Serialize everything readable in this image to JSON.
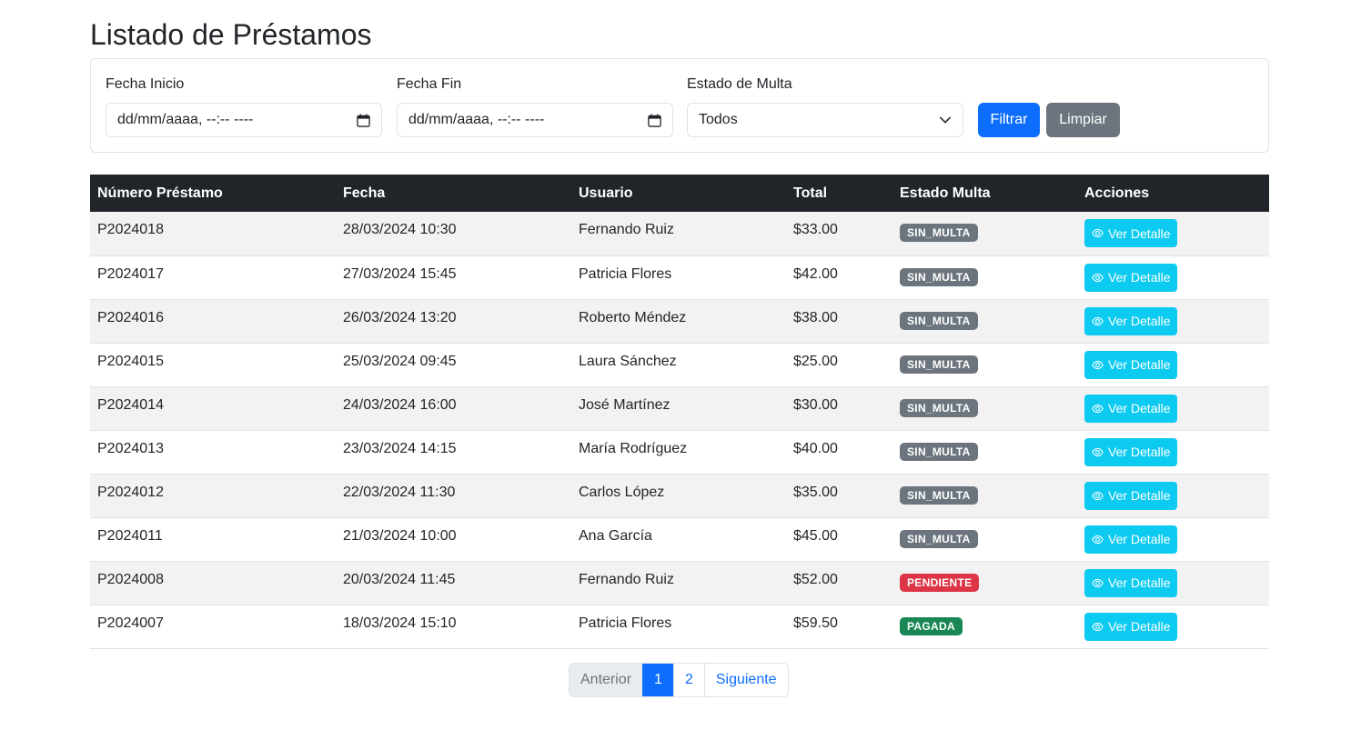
{
  "page_title": "Listado de Préstamos",
  "filters": {
    "fecha_inicio": {
      "label": "Fecha Inicio",
      "value": "dd/mm/aaaa, --:-- ----"
    },
    "fecha_fin": {
      "label": "Fecha Fin",
      "value": "dd/mm/aaaa, --:-- ----"
    },
    "estado_multa": {
      "label": "Estado de Multa",
      "value": "Todos"
    },
    "filter_button": "Filtrar",
    "clear_button": "Limpiar"
  },
  "table": {
    "headers": [
      "Número Préstamo",
      "Fecha",
      "Usuario",
      "Total",
      "Estado Multa",
      "Acciones"
    ],
    "action_label": "Ver Detalle",
    "rows": [
      {
        "numero": "P2024018",
        "fecha": "28/03/2024 10:30",
        "usuario": "Fernando Ruiz",
        "total": "$33.00",
        "estado": "SIN_MULTA"
      },
      {
        "numero": "P2024017",
        "fecha": "27/03/2024 15:45",
        "usuario": "Patricia Flores",
        "total": "$42.00",
        "estado": "SIN_MULTA"
      },
      {
        "numero": "P2024016",
        "fecha": "26/03/2024 13:20",
        "usuario": "Roberto Méndez",
        "total": "$38.00",
        "estado": "SIN_MULTA"
      },
      {
        "numero": "P2024015",
        "fecha": "25/03/2024 09:45",
        "usuario": "Laura Sánchez",
        "total": "$25.00",
        "estado": "SIN_MULTA"
      },
      {
        "numero": "P2024014",
        "fecha": "24/03/2024 16:00",
        "usuario": "José Martínez",
        "total": "$30.00",
        "estado": "SIN_MULTA"
      },
      {
        "numero": "P2024013",
        "fecha": "23/03/2024 14:15",
        "usuario": "María Rodríguez",
        "total": "$40.00",
        "estado": "SIN_MULTA"
      },
      {
        "numero": "P2024012",
        "fecha": "22/03/2024 11:30",
        "usuario": "Carlos López",
        "total": "$35.00",
        "estado": "SIN_MULTA"
      },
      {
        "numero": "P2024011",
        "fecha": "21/03/2024 10:00",
        "usuario": "Ana García",
        "total": "$45.00",
        "estado": "SIN_MULTA"
      },
      {
        "numero": "P2024008",
        "fecha": "20/03/2024 11:45",
        "usuario": "Fernando Ruiz",
        "total": "$52.00",
        "estado": "PENDIENTE"
      },
      {
        "numero": "P2024007",
        "fecha": "18/03/2024 15:10",
        "usuario": "Patricia Flores",
        "total": "$59.50",
        "estado": "PAGADA"
      }
    ]
  },
  "status_colors": {
    "SIN_MULTA": "#6c757d",
    "PENDIENTE": "#dc3545",
    "PAGADA": "#198754"
  },
  "pagination": {
    "prev": "Anterior",
    "pages": [
      "1",
      "2"
    ],
    "active_page": "1",
    "next": "Siguiente"
  }
}
